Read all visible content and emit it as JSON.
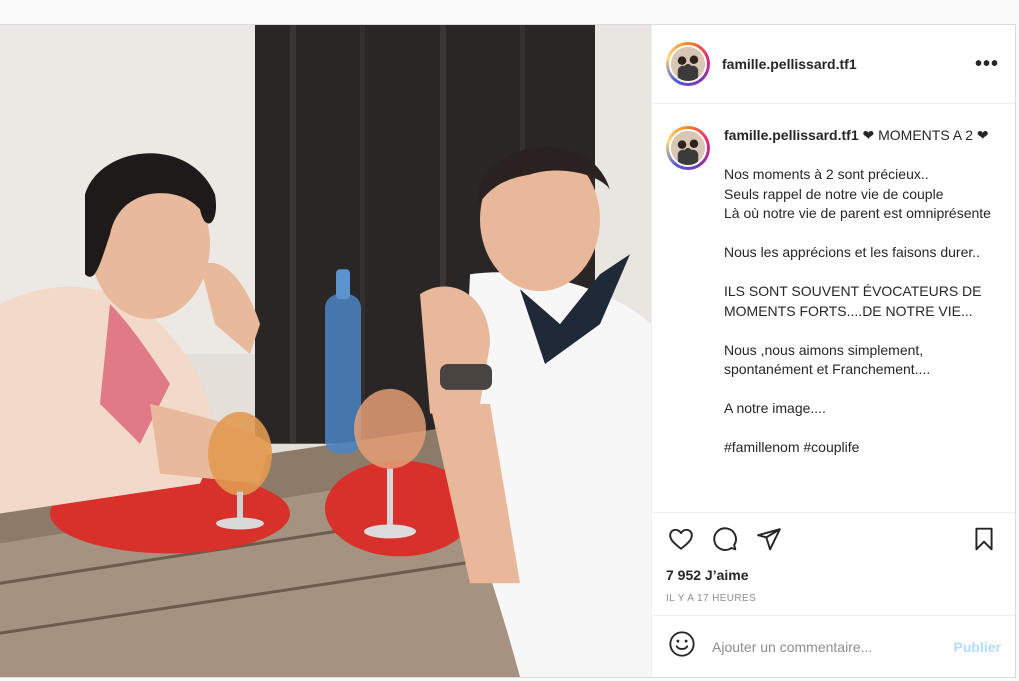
{
  "post": {
    "author": "famille.pellissard.tf1",
    "caption_title": "❤ MOMENTS A 2 ❤",
    "caption_paragraphs": [
      [
        "Nos moments à 2 sont précieux..",
        "Seuls rappel de notre vie de couple",
        "Là où notre vie de parent est omniprésente"
      ],
      [
        "Nous les apprécions et les faisons durer.."
      ],
      [
        "ILS SONT SOUVENT ÉVOCATEURS DE MOMENTS FORTS....DE NOTRE VIE..."
      ],
      [
        "Nous ,nous aimons simplement, spontanément et Franchement...."
      ],
      [
        "A notre image...."
      ],
      [
        "#famillenom #couplife"
      ]
    ],
    "likes": "7 952 J’aime",
    "timestamp": "IL Y A 17 HEURES",
    "more_label": "•••"
  },
  "comment": {
    "placeholder": "Ajouter un commentaire...",
    "publish_label": "Publier"
  },
  "icons": {
    "like": "heart-icon",
    "comment": "comment-icon",
    "share": "share-icon",
    "save": "bookmark-icon",
    "emoji": "emoji-icon",
    "more": "more-options-icon"
  },
  "colors": {
    "publish_disabled": "#b3dbff",
    "meta_text": "#8e8e8e",
    "border": "#dbdbdb"
  }
}
